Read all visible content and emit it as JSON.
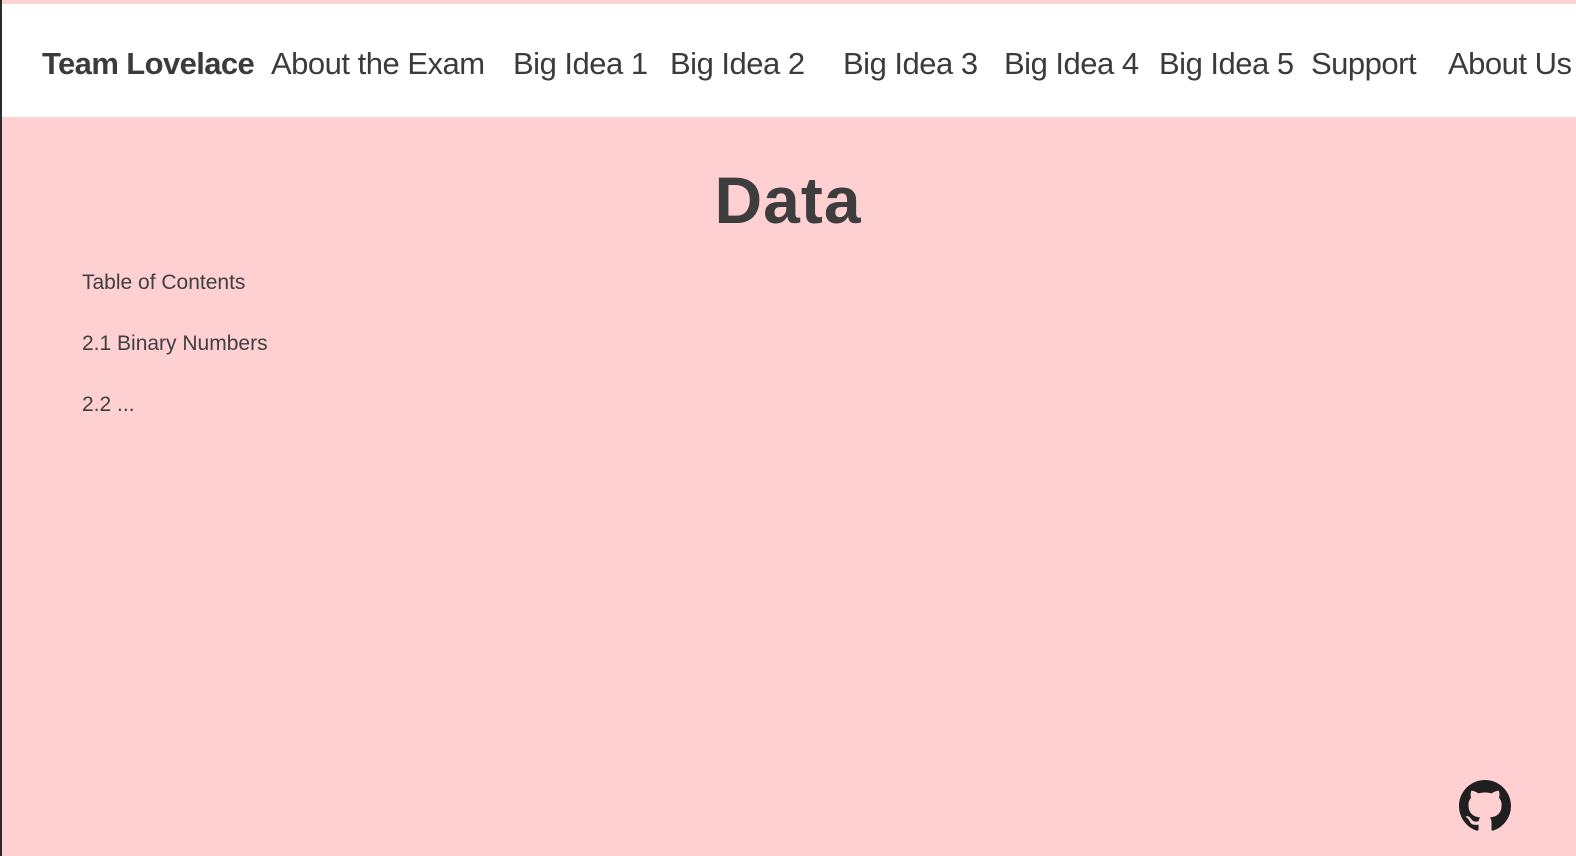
{
  "navbar": {
    "brand": "Team Lovelace",
    "items": [
      {
        "label": "About the Exam"
      },
      {
        "label": "Big Idea 1"
      },
      {
        "label": "Big Idea 2"
      },
      {
        "label": "Big Idea 3"
      },
      {
        "label": "Big Idea 4"
      },
      {
        "label": "Big Idea 5"
      },
      {
        "label": "Support"
      },
      {
        "label": "About Us"
      }
    ]
  },
  "main": {
    "title": "Data",
    "toc": [
      {
        "text": "Table of Contents"
      },
      {
        "text": "2.1 Binary Numbers"
      },
      {
        "text": "2.2  ..."
      }
    ]
  },
  "footer": {
    "icon": "github-icon"
  },
  "colors": {
    "page_background": "#fed0d2",
    "navbar_background": "#ffffff",
    "text": "#3b3b3b"
  }
}
